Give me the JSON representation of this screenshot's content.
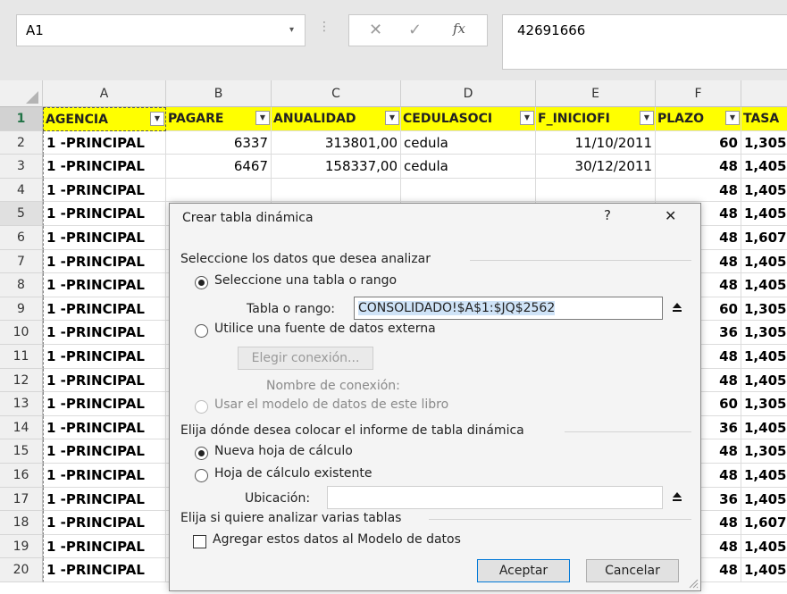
{
  "formula_bar": {
    "name_box": "A1",
    "dropdown_glyph": "▾",
    "separator_glyph": "⋮",
    "cancel_glyph": "✕",
    "enter_glyph": "✓",
    "fx_glyph": "fx",
    "formula": "42691666"
  },
  "columns": [
    "A",
    "B",
    "C",
    "D",
    "E",
    "F"
  ],
  "headers": [
    "AGENCIA",
    "PAGARE",
    "ANUALIDAD",
    "CEDULASOCI",
    "F_INICIOFI",
    "PLAZO",
    "TASA"
  ],
  "row_numbers": [
    "1",
    "2",
    "3",
    "4",
    "5",
    "6",
    "7",
    "8",
    "9",
    "10",
    "11",
    "12",
    "13",
    "14",
    "15",
    "16",
    "17",
    "18",
    "19",
    "20"
  ],
  "rows": [
    {
      "agencia": "1  -PRINCIPAL",
      "pagare": "6337",
      "anualidad": "313801,00",
      "cedula": "cedula",
      "fecha": "11/10/2011",
      "plazo": "60",
      "tasa": "1,305"
    },
    {
      "agencia": "1  -PRINCIPAL",
      "pagare": "6467",
      "anualidad": "158337,00",
      "cedula": "cedula",
      "fecha": "30/12/2011",
      "plazo": "48",
      "tasa": "1,405"
    },
    {
      "agencia": "1  -PRINCIPAL",
      "plazo": "48",
      "tasa": "1,405"
    },
    {
      "agencia": "1  -PRINCIPAL",
      "plazo": "48",
      "tasa": "1,405"
    },
    {
      "agencia": "1  -PRINCIPAL",
      "plazo": "48",
      "tasa": "1,607"
    },
    {
      "agencia": "1  -PRINCIPAL",
      "plazo": "48",
      "tasa": "1,405"
    },
    {
      "agencia": "1  -PRINCIPAL",
      "plazo": "48",
      "tasa": "1,405"
    },
    {
      "agencia": "1  -PRINCIPAL",
      "plazo": "60",
      "tasa": "1,305"
    },
    {
      "agencia": "1  -PRINCIPAL",
      "plazo": "36",
      "tasa": "1,305"
    },
    {
      "agencia": "1  -PRINCIPAL",
      "plazo": "48",
      "tasa": "1,405"
    },
    {
      "agencia": "1  -PRINCIPAL",
      "plazo": "48",
      "tasa": "1,405"
    },
    {
      "agencia": "1  -PRINCIPAL",
      "plazo": "60",
      "tasa": "1,305"
    },
    {
      "agencia": "1  -PRINCIPAL",
      "plazo": "36",
      "tasa": "1,405"
    },
    {
      "agencia": "1  -PRINCIPAL",
      "plazo": "48",
      "tasa": "1,305"
    },
    {
      "agencia": "1  -PRINCIPAL",
      "plazo": "48",
      "tasa": "1,405"
    },
    {
      "agencia": "1  -PRINCIPAL",
      "plazo": "36",
      "tasa": "1,405"
    },
    {
      "agencia": "1  -PRINCIPAL",
      "plazo": "48",
      "tasa": "1,607"
    },
    {
      "agencia": "1  -PRINCIPAL",
      "plazo": "48",
      "tasa": "1,405"
    },
    {
      "agencia": "1  -PRINCIPAL",
      "plazo": "48",
      "tasa": "1,405"
    }
  ],
  "dialog": {
    "title": "Crear tabla dinámica",
    "help": "?",
    "close": "✕",
    "section1": "Seleccione los datos que desea analizar",
    "opt_table": "Seleccione una tabla o rango",
    "range_label": "Tabla o rango:",
    "range_value": "CONSOLIDADO!$A$1:$JQ$2562",
    "opt_external": "Utilice una fuente de datos externa",
    "choose_conn": "Elegir conexión...",
    "conn_name": "Nombre de conexión:",
    "opt_model": "Usar el modelo de datos de este libro",
    "section2": "Elija dónde desea colocar el informe de tabla dinámica",
    "opt_new": "Nueva hoja de cálculo",
    "opt_existing": "Hoja de cálculo existente",
    "location_label": "Ubicación:",
    "location_value": "",
    "section3": "Elija si quiere analizar varias tablas",
    "add_model": "Agregar estos datos al Modelo de datos",
    "ok": "Aceptar",
    "cancel": "Cancelar",
    "ref_glyph": "⯅"
  }
}
